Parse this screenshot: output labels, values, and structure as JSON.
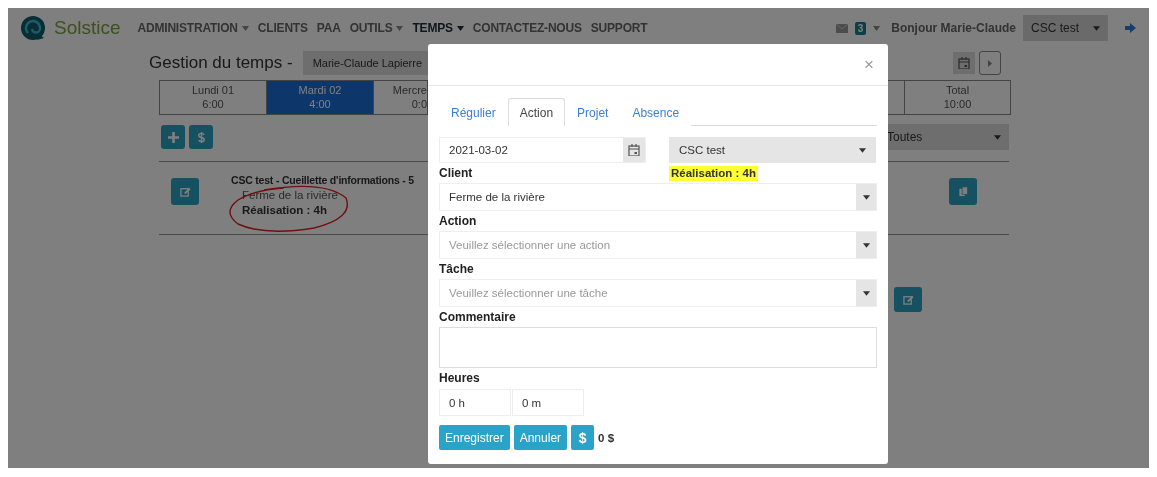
{
  "navbar": {
    "brand": "Solstice",
    "menu": [
      {
        "label": "ADMINISTRATION",
        "dropdown": true,
        "active": false
      },
      {
        "label": "CLIENTS",
        "dropdown": false,
        "active": false
      },
      {
        "label": "PAA",
        "dropdown": false,
        "active": false
      },
      {
        "label": "OUTILS",
        "dropdown": true,
        "active": false
      },
      {
        "label": "TEMPS",
        "dropdown": true,
        "active": true
      },
      {
        "label": "CONTACTEZ-NOUS",
        "dropdown": false,
        "active": false
      },
      {
        "label": "SUPPORT",
        "dropdown": false,
        "active": false
      }
    ],
    "messages_count": "3",
    "greeting": "Bonjour Marie-Claude",
    "account_select": "CSC test"
  },
  "page": {
    "title": "Gestion du temps -",
    "user_select": "Marie-Claude Lapierre",
    "days": [
      {
        "day": "Lundi 01",
        "hours": "6:00",
        "selected": false
      },
      {
        "day": "Mardi 02",
        "hours": "4:00",
        "selected": true
      },
      {
        "day": "Mercre",
        "hours": "0:0",
        "selected": false
      }
    ],
    "total": {
      "label": "Total",
      "hours": "10:00"
    },
    "filter_select": "Toutes",
    "entries": [
      {
        "title": "CSC test - Cueillette d'informations - 5",
        "client": "Ferme de la rivière",
        "realisation": "Réalisation : 4h",
        "annotated": true
      }
    ]
  },
  "modal": {
    "close": "×",
    "tabs": [
      {
        "label": "Régulier",
        "selected": false
      },
      {
        "label": "Action",
        "selected": true
      },
      {
        "label": "Projet",
        "selected": false
      },
      {
        "label": "Absence",
        "selected": false
      }
    ],
    "date": "2021-03-02",
    "project_select": "CSC test",
    "realisation": {
      "text": "Réalisation : 4h",
      "highlighted": true
    },
    "fields": [
      {
        "label": "Client",
        "value": "Ferme de la rivière"
      },
      {
        "label": "Action",
        "placeholder": "Veuillez sélectionner une action"
      },
      {
        "label": "Tâche",
        "placeholder": "Veuillez sélectionner une tâche"
      }
    ],
    "comment_label": "Commentaire",
    "hours_label": "Heures",
    "hours_value": "0 h",
    "minutes_value": "0 m",
    "buttons": [
      {
        "label": "Enregistrer",
        "kind": "text"
      },
      {
        "label": "Annuler",
        "kind": "text"
      },
      {
        "label": "$",
        "kind": "icon"
      }
    ],
    "amount": "0 $"
  }
}
